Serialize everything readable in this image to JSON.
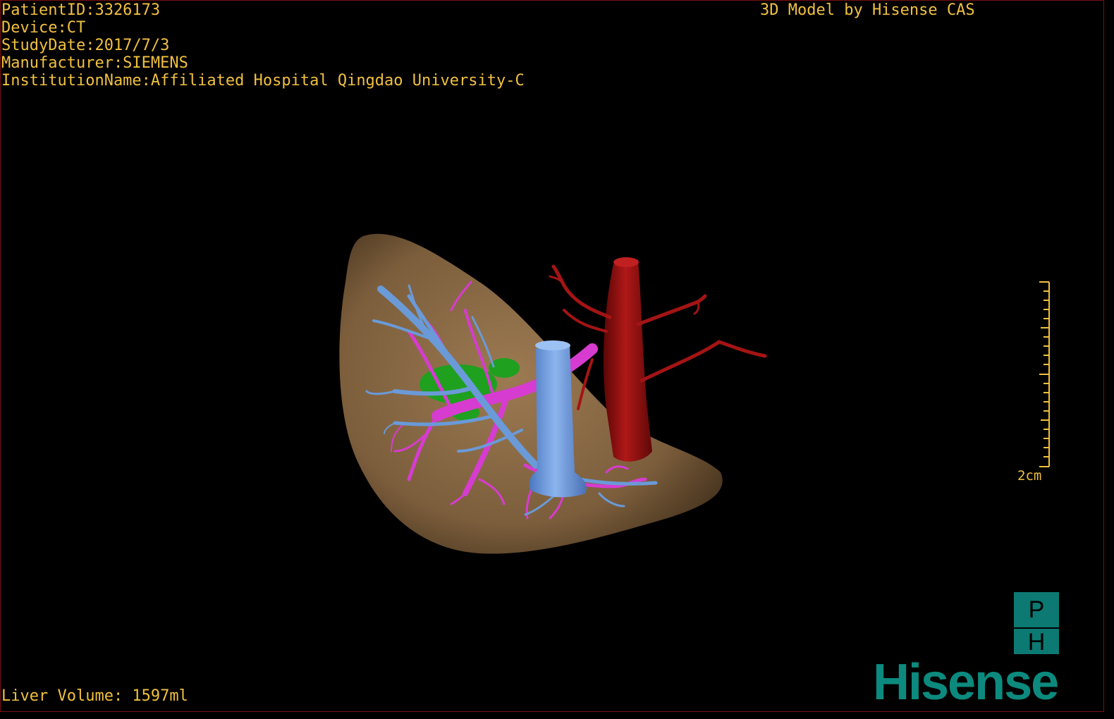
{
  "header_info": {
    "patient_id": "PatientID:3326173",
    "device": "Device:CT",
    "study_date": "StudyDate:2017/7/3",
    "manufacturer": "Manufacturer:SIEMENS",
    "institution": "InstitutionName:Affiliated Hospital Qingdao University-C"
  },
  "model_title": "3D Model by Hisense CAS",
  "volume_text": "Liver Volume: 1597ml",
  "scale_bar": {
    "label": "2cm"
  },
  "logo": {
    "letter_top": "P",
    "letter_bottom": "H",
    "brand": "Hisense"
  },
  "colors": {
    "text": "#f0c040",
    "liver": "#8c6c48",
    "portal_vein": "#6a9ad8",
    "hepatic_vein": "#d63cd0",
    "artery": "#9a1010",
    "gallbladder": "#1fa01f",
    "brand": "#0c8a7e"
  }
}
